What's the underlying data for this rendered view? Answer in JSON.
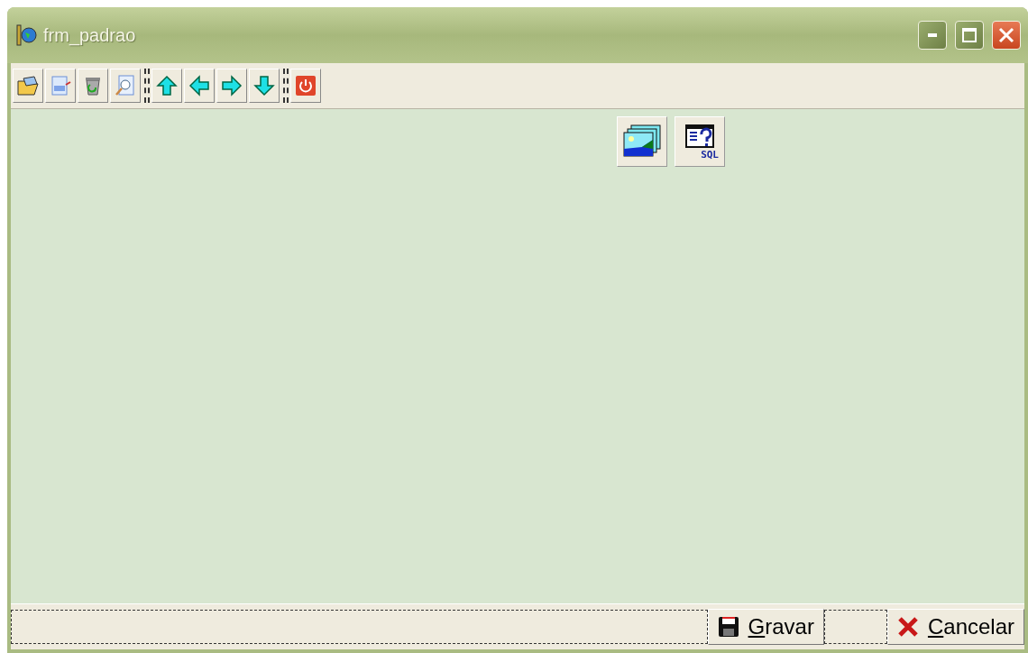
{
  "window": {
    "title": "frm_padrao"
  },
  "toolbar": {
    "groups": [
      {
        "buttons": [
          {
            "kind": "open"
          },
          {
            "kind": "save"
          },
          {
            "kind": "delete"
          },
          {
            "kind": "search"
          }
        ]
      },
      {
        "buttons": [
          {
            "kind": "up"
          },
          {
            "kind": "left"
          },
          {
            "kind": "right"
          },
          {
            "kind": "down"
          }
        ]
      },
      {
        "buttons": [
          {
            "kind": "exit"
          }
        ]
      }
    ]
  },
  "canvas_buttons": [
    {
      "kind": "picture"
    },
    {
      "kind": "sql",
      "caption": "SQL"
    }
  ],
  "footer": {
    "buttons": [
      {
        "kind": "save",
        "label": "Gravar"
      },
      {
        "kind": "cancel",
        "label": "Cancelar"
      }
    ]
  }
}
